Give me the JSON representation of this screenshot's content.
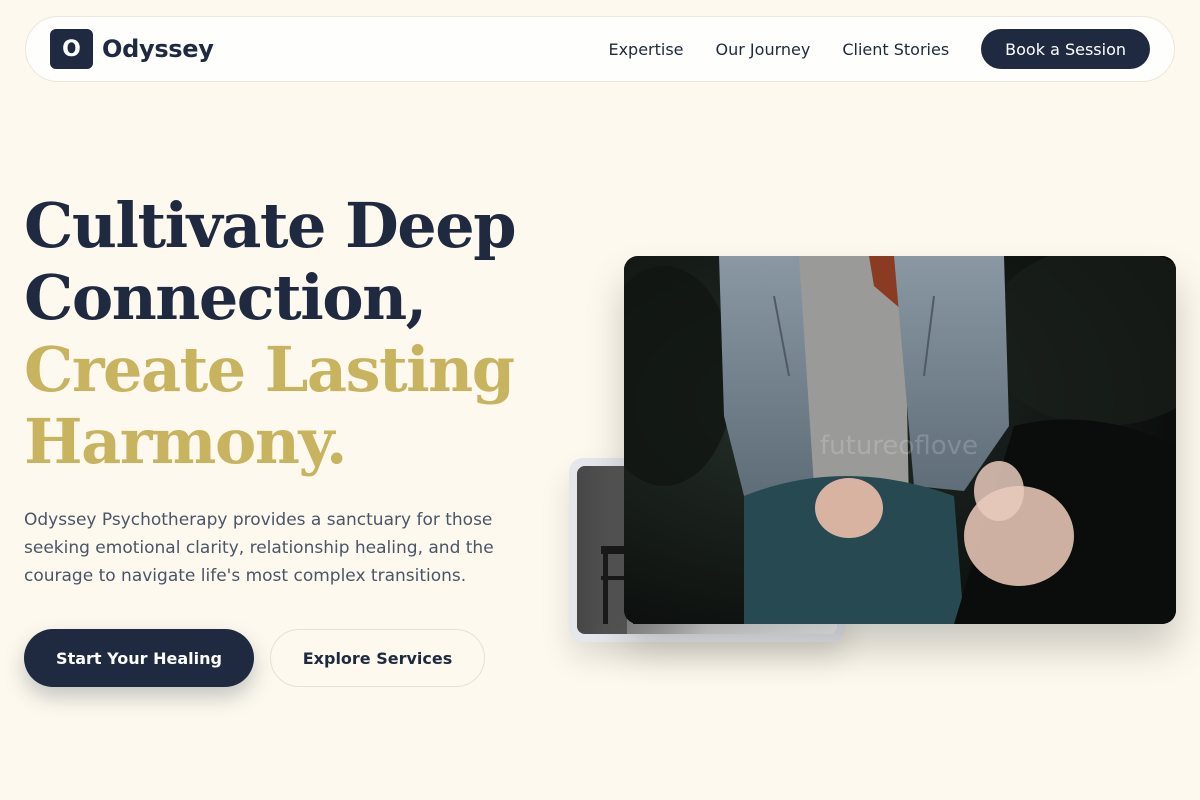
{
  "brand": {
    "logo_letter": "O",
    "name": "Odyssey"
  },
  "nav": {
    "links": [
      "Expertise",
      "Our Journey",
      "Client Stories"
    ],
    "cta_label": "Book a Session"
  },
  "hero": {
    "headline_dark_1": "Cultivate Deep",
    "headline_dark_2": "Connection,",
    "headline_gold_1": "Create Lasting",
    "headline_gold_2": "Harmony.",
    "description": "Odyssey Psychotherapy provides a sanctuary for those seeking emotional clarity, relationship healing, and the courage to navigate life's most complex transitions.",
    "primary_button": "Start Your Healing",
    "secondary_button": "Explore Services"
  },
  "images": {
    "main_watermark": "futureoflove"
  },
  "colors": {
    "navy": "#1f2a40",
    "gold": "#c8b35e",
    "background": "#fdf9ee"
  }
}
